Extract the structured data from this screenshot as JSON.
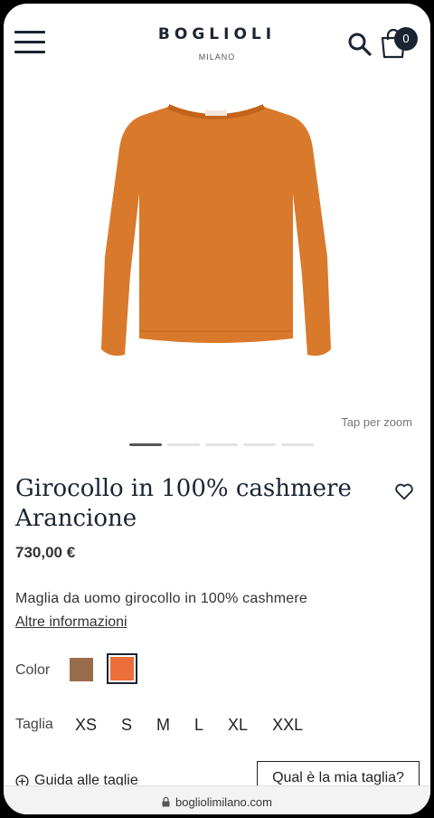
{
  "header": {
    "brand": "BOGLIOLI",
    "brand_sub": "MILANO",
    "cart_count": "0"
  },
  "icons": {
    "menu": "hamburger-menu-icon",
    "search": "search-icon",
    "cart": "shopping-bag-icon",
    "wishlist": "heart-icon",
    "guide": "plus-circle-icon",
    "lock": "lock-icon"
  },
  "gallery": {
    "zoom_hint": "Tap per zoom",
    "slides": 5,
    "active_slide": 1
  },
  "product": {
    "title": "Girocollo in 100% cashmere Arancione",
    "price": "730,00 €",
    "description": "Maglia da uomo girocollo in 100% cashmere",
    "more_link": "Altre informazioni",
    "garment_color": "#d9792b"
  },
  "options": {
    "color_label": "Color",
    "colors": [
      "#9a6b4a",
      "#ec6e3a"
    ],
    "selected_color": 1,
    "size_label": "Taglia",
    "sizes": [
      "XS",
      "S",
      "M",
      "L",
      "XL",
      "XXL"
    ]
  },
  "footer_actions": {
    "guide_label": "Guida alle taglie",
    "fit_button": "Qual è la mia taglia?"
  },
  "browser": {
    "url": "bogliolimilano.com"
  }
}
